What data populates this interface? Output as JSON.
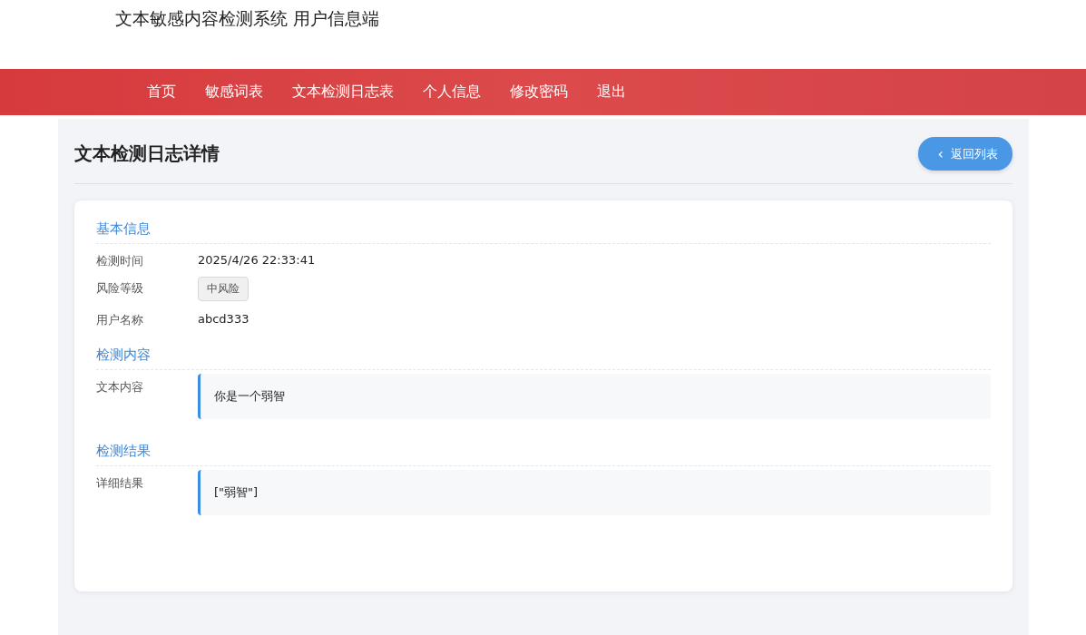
{
  "header": {
    "title": "文本敏感内容检测系统 用户信息端"
  },
  "nav": [
    {
      "label": "首页"
    },
    {
      "label": "敏感词表"
    },
    {
      "label": "文本检测日志表"
    },
    {
      "label": "个人信息"
    },
    {
      "label": "修改密码"
    },
    {
      "label": "退出"
    }
  ],
  "page": {
    "title": "文本检测日志详情",
    "back_button": {
      "icon": "‹",
      "label": "返回列表"
    }
  },
  "sections": [
    {
      "title": "基本信息",
      "fields": [
        {
          "label": "检测时间",
          "kind": "text",
          "value": "2025/4/26 22:33:41"
        },
        {
          "label": "风险等级",
          "kind": "tag",
          "value": "中风险"
        },
        {
          "label": "用户名称",
          "kind": "text",
          "value": "abcd333"
        }
      ]
    },
    {
      "title": "检测内容",
      "fields": [
        {
          "label": "文本内容",
          "kind": "block",
          "value": "你是一个弱智"
        }
      ]
    },
    {
      "title": "检测结果",
      "fields": [
        {
          "label": "详细结果",
          "kind": "block",
          "value": "[\"弱智\"]"
        }
      ]
    }
  ]
}
